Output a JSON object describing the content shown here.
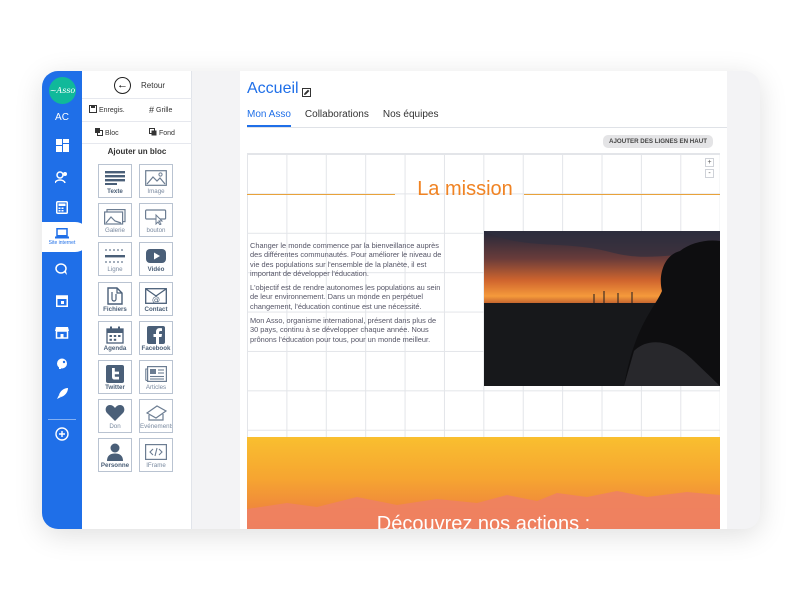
{
  "app": {
    "logo_text": "~Asso",
    "initials": "AC",
    "active_nav_label": "Site internet"
  },
  "panel": {
    "back_label": "Retour",
    "buttons": {
      "save": "Enregis.",
      "grid": "Grille",
      "block": "Bloc",
      "background": "Fond"
    },
    "add_title": "Ajouter un bloc",
    "tiles": [
      {
        "label": "Texte",
        "icon": "text-icon"
      },
      {
        "label": "Image",
        "icon": "image-icon"
      },
      {
        "label": "Galerie",
        "icon": "gallery-icon"
      },
      {
        "label": "bouton",
        "icon": "cursor-button-icon"
      },
      {
        "label": "Ligne",
        "icon": "line-icon"
      },
      {
        "label": "Vidéo",
        "icon": "video-icon"
      },
      {
        "label": "Fichiers",
        "icon": "file-icon"
      },
      {
        "label": "Contact",
        "icon": "email-icon"
      },
      {
        "label": "Agenda",
        "icon": "calendar-icon"
      },
      {
        "label": "Facebook",
        "icon": "facebook-icon"
      },
      {
        "label": "Twitter",
        "icon": "twitter-icon"
      },
      {
        "label": "Articles",
        "icon": "articles-icon"
      },
      {
        "label": "Don",
        "icon": "heart-icon"
      },
      {
        "label": "Evénements",
        "icon": "events-icon"
      },
      {
        "label": "Personne",
        "icon": "person-icon"
      },
      {
        "label": "IFrame",
        "icon": "iframe-icon"
      }
    ]
  },
  "editor": {
    "page_title": "Accueil",
    "tabs": [
      "Mon Asso",
      "Collaborations",
      "Nos équipes"
    ],
    "add_rows_button": "AJOUTER DES LIGNES EN HAUT",
    "plus": "+",
    "minus": "-",
    "mission_title": "La mission",
    "paragraphs": [
      "Changer le monde commence par la bienveillance auprès des différentes communautés. Pour améliorer le niveau de vie des populations sur l'ensemble de la planète, il est important de développer l'éducation.",
      "L'objectif est de rendre autonomes les populations au sein de leur environnement. Dans un monde en perpétuel changement, l'éducation continue est une nécessité.",
      "Mon Asso, organisme international, présent dans plus de 30 pays, continu à se développer chaque année. Nous prônons l'éducation pour tous, pour un monde meilleur."
    ],
    "banner_title": "Découvrez nos actions :"
  },
  "colors": {
    "primary": "#1f6fe8",
    "accent_orange": "#f08323",
    "logo_teal": "#10b99a"
  }
}
